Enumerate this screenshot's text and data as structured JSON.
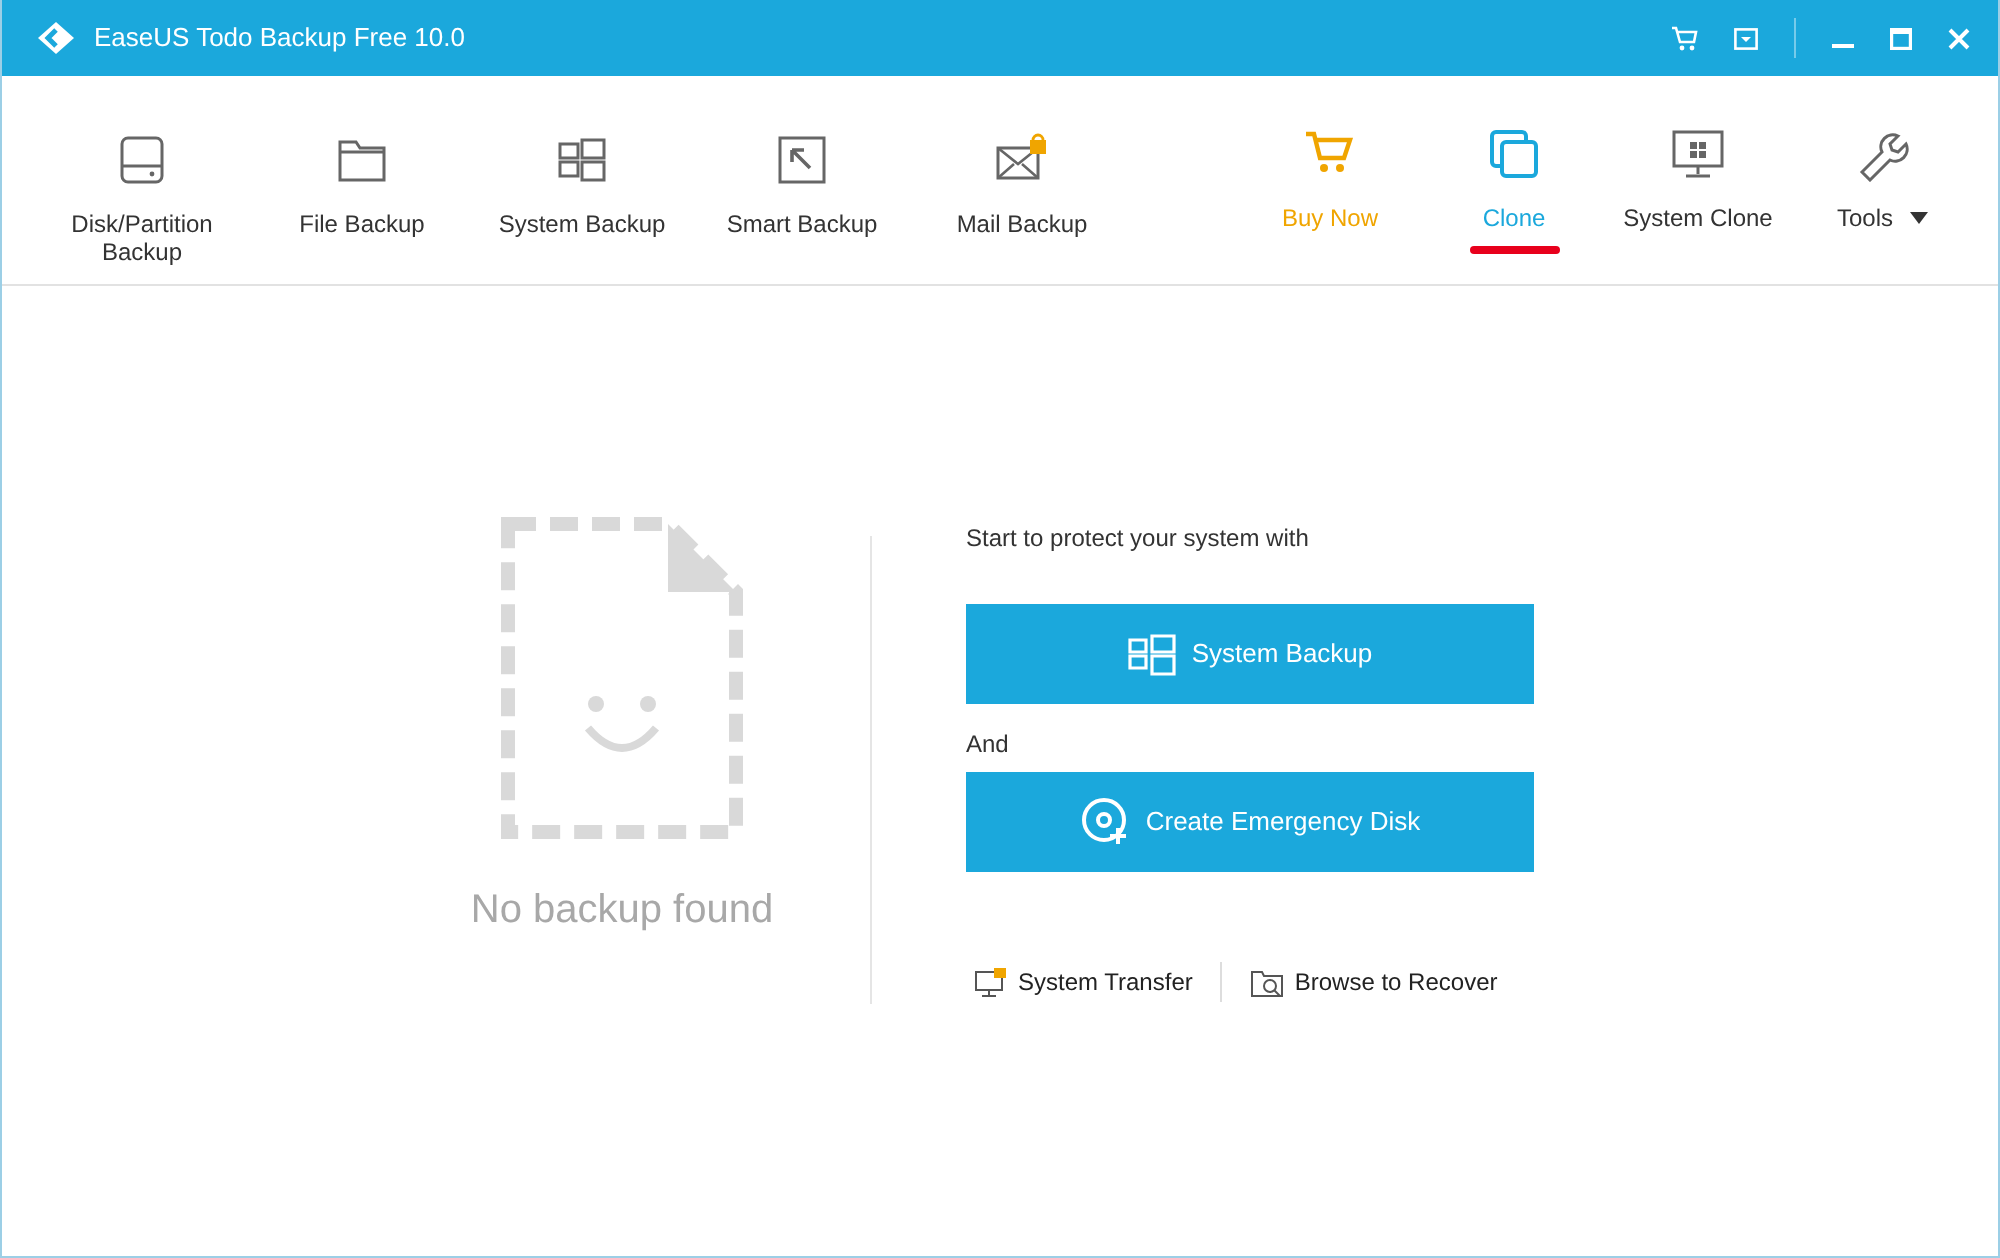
{
  "window": {
    "title": "EaseUS Todo Backup Free 10.0"
  },
  "toolbar_left": [
    {
      "label": "Disk/Partition Backup"
    },
    {
      "label": "File Backup"
    },
    {
      "label": "System Backup"
    },
    {
      "label": "Smart Backup"
    },
    {
      "label": "Mail Backup"
    }
  ],
  "toolbar_right": [
    {
      "label": "Buy Now",
      "kind": "promo",
      "selected": false
    },
    {
      "label": "Clone",
      "kind": "tool",
      "selected": true
    },
    {
      "label": "System Clone",
      "kind": "tool",
      "selected": false
    },
    {
      "label": "Tools",
      "kind": "menu",
      "selected": false
    }
  ],
  "empty_state": {
    "message": "No backup found"
  },
  "start": {
    "intro": "Start to protect your system with",
    "primary_button": "System Backup",
    "joiner": "And",
    "secondary_button": "Create Emergency Disk"
  },
  "links": [
    "System Transfer",
    "Browse to Recover"
  ]
}
